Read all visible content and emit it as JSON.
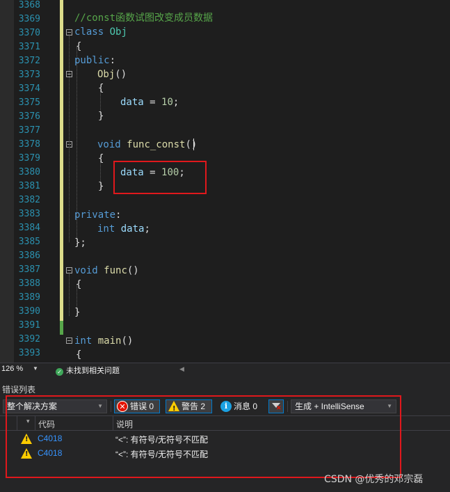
{
  "editor": {
    "line_numbers": [
      "3368",
      "3369",
      "3370",
      "3371",
      "3372",
      "3373",
      "3374",
      "3375",
      "3376",
      "3377",
      "3378",
      "3379",
      "3380",
      "3381",
      "3382",
      "3383",
      "3384",
      "3385",
      "3386",
      "3387",
      "3388",
      "3389",
      "3390",
      "3391",
      "3392",
      "3393"
    ],
    "comment": "//const函数试图改变成员数据",
    "kw_class": "class",
    "class_name": "Obj",
    "kw_public": "public",
    "ctor_name": "Obj",
    "id_data": "data",
    "val_10": "10",
    "kw_void": "void",
    "func_const_name": "func_const",
    "val_100": "100",
    "kw_private": "private",
    "kw_int": "int",
    "func_name": "func",
    "main_name": "main"
  },
  "status": {
    "zoom": "126 %",
    "issues_text": "未找到相关问题"
  },
  "error_list": {
    "title": "错误列表",
    "scope": "整个解决方案",
    "errors_label": "错误 0",
    "warnings_label": "警告 2",
    "messages_label": "消息 0",
    "build_filter": "生成 + IntelliSense",
    "col_code": "代码",
    "col_desc": "说明",
    "rows": [
      {
        "code": "C4018",
        "desc": "“<”: 有符号/无符号不匹配"
      },
      {
        "code": "C4018",
        "desc": "“<”: 有符号/无符号不匹配"
      }
    ]
  },
  "watermark": "CSDN @优秀的邓宗磊",
  "colors": {
    "keyword": "#569cd6",
    "comment": "#57a64a",
    "number": "#b5cea8",
    "function": "#dcdcaa",
    "type": "#4ec9b0",
    "variable": "#9cdcfe",
    "line_number": "#2b91af",
    "annotation_red": "#e0181c",
    "change_saved": "#dcdc8b",
    "change_unsaved": "#57a64a"
  }
}
